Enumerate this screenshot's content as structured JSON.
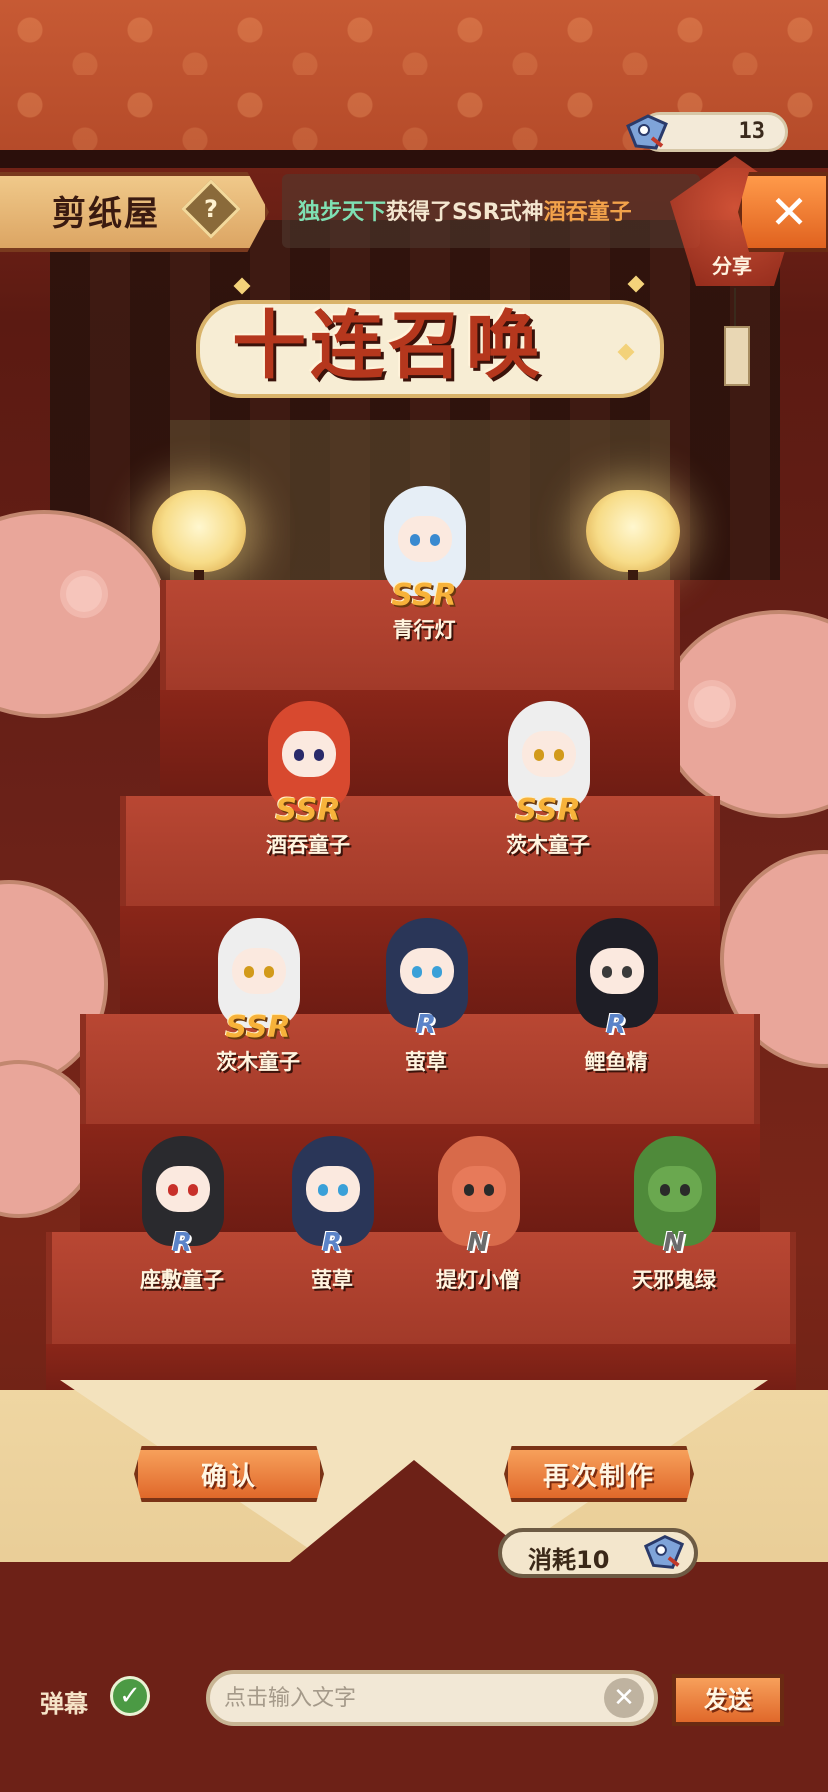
{
  "header": {
    "shop_title": "剪纸屋",
    "help_symbol": "?",
    "ticket_count": "13",
    "close_symbol": "✕",
    "share_label": "分享"
  },
  "announcement": {
    "player": "独步天下",
    "middle": "获得了SSR式神",
    "shikigami": "酒吞童子"
  },
  "banner": {
    "title": "十连召唤"
  },
  "results": [
    {
      "rarity": "SSR",
      "name": "青行灯"
    },
    {
      "rarity": "SSR",
      "name": "酒吞童子"
    },
    {
      "rarity": "SSR",
      "name": "茨木童子"
    },
    {
      "rarity": "SSR",
      "name": "茨木童子"
    },
    {
      "rarity": "R",
      "name": "萤草"
    },
    {
      "rarity": "R",
      "name": "鲤鱼精"
    },
    {
      "rarity": "R",
      "name": "座敷童子"
    },
    {
      "rarity": "R",
      "name": "萤草"
    },
    {
      "rarity": "N",
      "name": "提灯小僧"
    },
    {
      "rarity": "N",
      "name": "天邪鬼绿"
    }
  ],
  "actions": {
    "confirm": "确认",
    "again": "再次制作",
    "cost_label": "消耗10"
  },
  "chat": {
    "danmaku_label": "弹幕",
    "check_symbol": "✓",
    "input_placeholder": "点击输入文字",
    "clear_symbol": "✕",
    "send": "发送"
  },
  "colors": {
    "ssr": "#f7b23a",
    "r": "#5a83c8",
    "n": "#6b6b6b",
    "accent_orange": "#e0682a"
  },
  "icons": {
    "ticket": "paper-doll-ticket-icon",
    "help": "question-icon",
    "close": "close-icon",
    "check": "check-icon",
    "clear": "clear-icon"
  }
}
